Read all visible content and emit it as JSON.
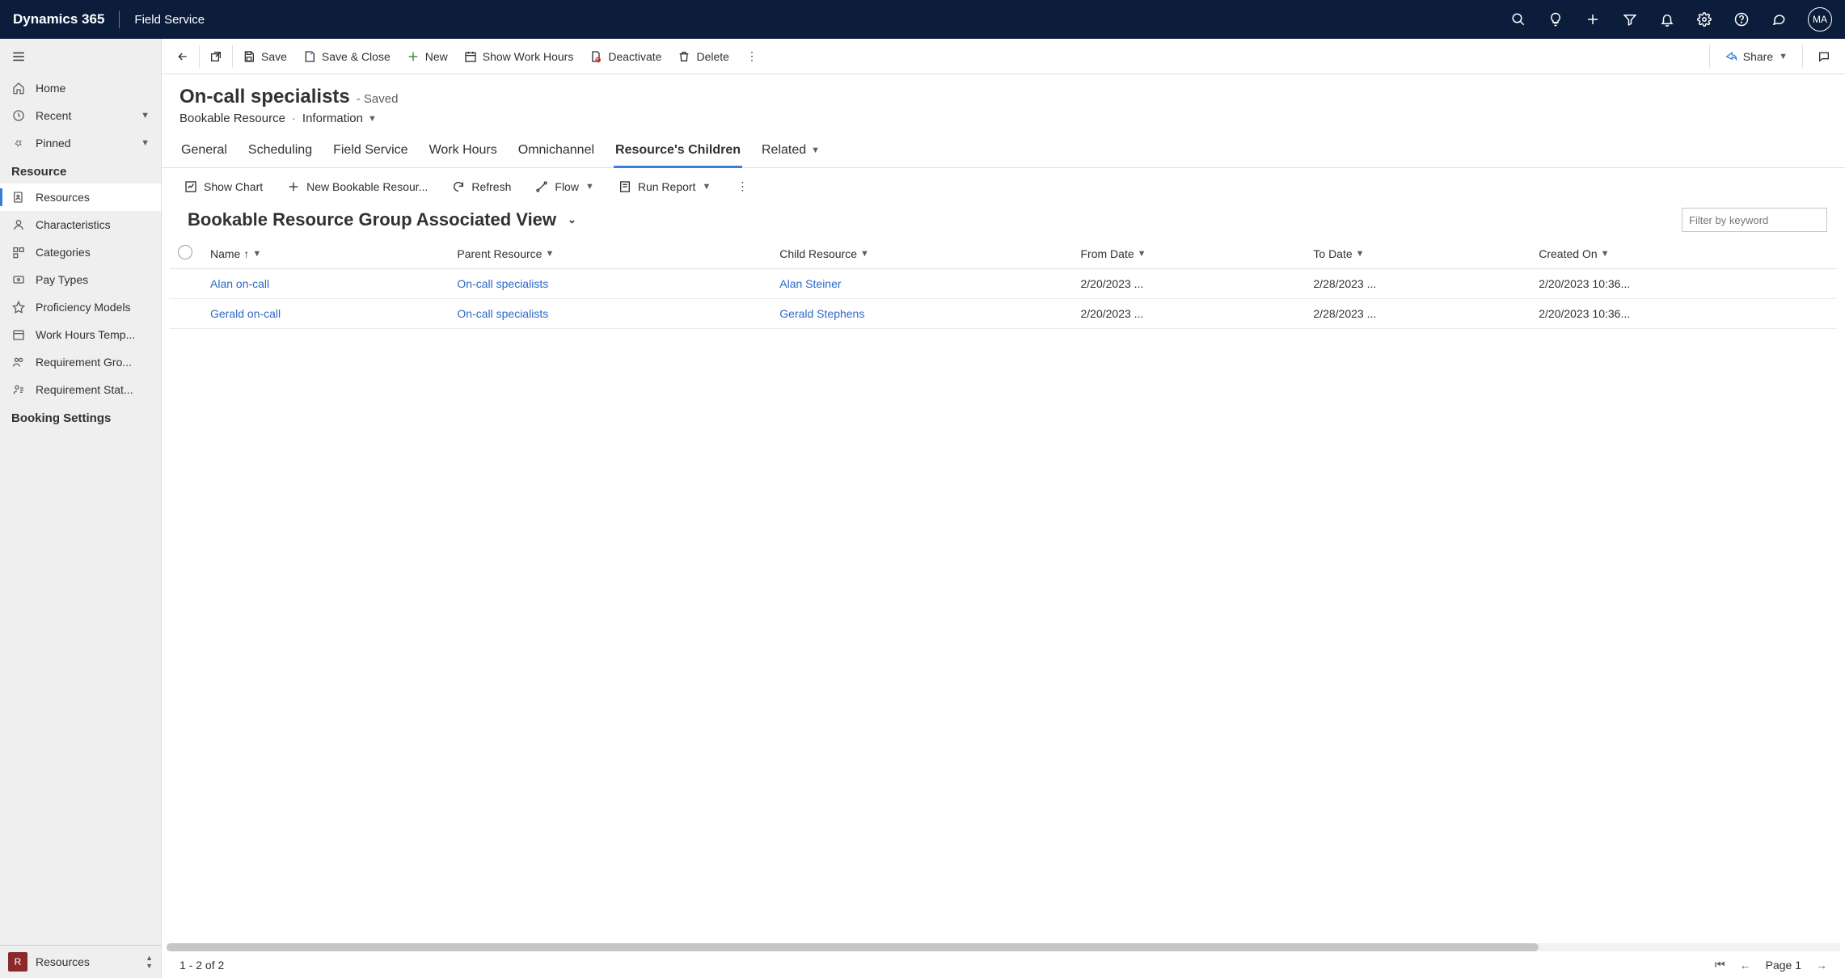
{
  "topbar": {
    "brand": "Dynamics 365",
    "app": "Field Service",
    "avatar": "MA"
  },
  "sidebar": {
    "home": "Home",
    "recent": "Recent",
    "pinned": "Pinned",
    "section_resource": "Resource",
    "items": [
      "Resources",
      "Characteristics",
      "Categories",
      "Pay Types",
      "Proficiency Models",
      "Work Hours Temp...",
      "Requirement Gro...",
      "Requirement Stat..."
    ],
    "section_booking": "Booking Settings",
    "footer_badge": "R",
    "footer_label": "Resources"
  },
  "cmdbar": {
    "save": "Save",
    "save_close": "Save & Close",
    "new": "New",
    "show_hours": "Show Work Hours",
    "deactivate": "Deactivate",
    "delete": "Delete",
    "share": "Share"
  },
  "record": {
    "title": "On-call specialists",
    "status": "- Saved",
    "entity": "Bookable Resource",
    "form": "Information"
  },
  "tabs": [
    "General",
    "Scheduling",
    "Field Service",
    "Work Hours",
    "Omnichannel",
    "Resource's Children",
    "Related"
  ],
  "active_tab": "Resource's Children",
  "subgrid_cmds": {
    "show_chart": "Show Chart",
    "new_child": "New Bookable Resour...",
    "refresh": "Refresh",
    "flow": "Flow",
    "run_report": "Run Report"
  },
  "view_name": "Bookable Resource Group Associated View",
  "filter_placeholder": "Filter by keyword",
  "columns": [
    "Name",
    "Parent Resource",
    "Child Resource",
    "From Date",
    "To Date",
    "Created On"
  ],
  "rows": [
    {
      "name": "Alan on-call",
      "parent": "On-call specialists",
      "child": "Alan Steiner",
      "from": "2/20/2023 ...",
      "to": "2/28/2023 ...",
      "created": "2/20/2023 10:36..."
    },
    {
      "name": "Gerald on-call",
      "parent": "On-call specialists",
      "child": "Gerald Stephens",
      "from": "2/20/2023 ...",
      "to": "2/28/2023 ...",
      "created": "2/20/2023 10:36..."
    }
  ],
  "pager": {
    "count": "1 - 2 of 2",
    "page": "Page 1"
  }
}
